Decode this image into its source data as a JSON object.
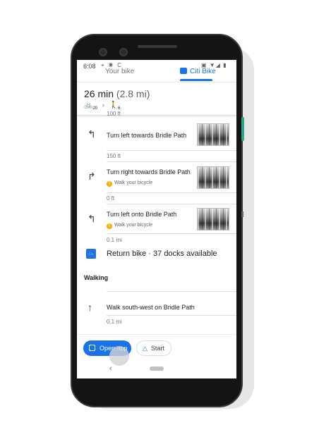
{
  "status_bar": {
    "time": "6:08",
    "left_icons": "⌖ ◉ C",
    "right_icons": "▣ ▼◢ ▮"
  },
  "tabs": [
    {
      "label": "Your bike",
      "active": false
    },
    {
      "label": "Citi Bike",
      "active": true
    }
  ],
  "summary": {
    "duration": "26 min",
    "distance": "(2.8 mi)",
    "bike_minutes": "20",
    "walk_minutes": "6"
  },
  "steps": [
    {
      "distance_before": "100 ft",
      "icon": "turn-left-icon",
      "text": "Turn left towards Bridle Path",
      "warning": ""
    },
    {
      "distance_before": "150 ft",
      "icon": "turn-right-icon",
      "text": "Turn right towards Bridle Path",
      "warning": "Walk your bicycle"
    },
    {
      "distance_before": "0 ft",
      "icon": "turn-left-icon",
      "text": "Turn left onto Bridle Path",
      "warning": "Walk your bicycle"
    }
  ],
  "after_steps_distance": "0.1 mi",
  "return_bike": {
    "text": "Return bike · 37 docks available"
  },
  "walking_section": {
    "heading": "Walking",
    "step": {
      "icon": "straight-arrow-icon",
      "text": "Walk south-west on Bridle Path"
    },
    "distance": "0.1 mi"
  },
  "actions": {
    "open_app_label": "Open app",
    "start_label": "Start"
  },
  "colors": {
    "accent": "#1a73e8",
    "warning": "#f9ab00",
    "power_button": "#2ea88a"
  }
}
